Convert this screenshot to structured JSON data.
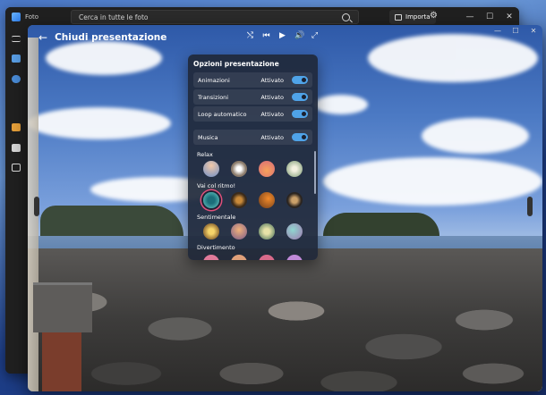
{
  "background_app": {
    "title": "Foto",
    "search_placeholder": "Cerca in tutte le foto",
    "import_label": "Importa",
    "window_controls": [
      "—",
      "☐",
      "✕"
    ]
  },
  "slideshow": {
    "back_icon": "←",
    "title": "Chiudi presentazione",
    "controls": [
      "shuffle-icon",
      "previous-icon",
      "play-icon",
      "volume-icon",
      "fullscreen-icon"
    ],
    "controls_glyphs": [
      "⤭",
      "⏮",
      "▶",
      "🔊",
      "⤢"
    ],
    "window_controls": [
      "—",
      "☐",
      "✕"
    ]
  },
  "options_panel": {
    "title": "Opzioni presentazione",
    "options": [
      {
        "label": "Animazioni",
        "state": "Attivato"
      },
      {
        "label": "Transizioni",
        "state": "Attivato"
      },
      {
        "label": "Loop automatico",
        "state": "Attivato"
      }
    ],
    "music": {
      "label": "Musica",
      "state": "Attivato"
    },
    "sections": [
      "Relax",
      "Vai col ritmo!",
      "Sentimentale",
      "Divertimento"
    ],
    "accent_color": "#4fa3e8",
    "selected_color": "#e0507a"
  }
}
